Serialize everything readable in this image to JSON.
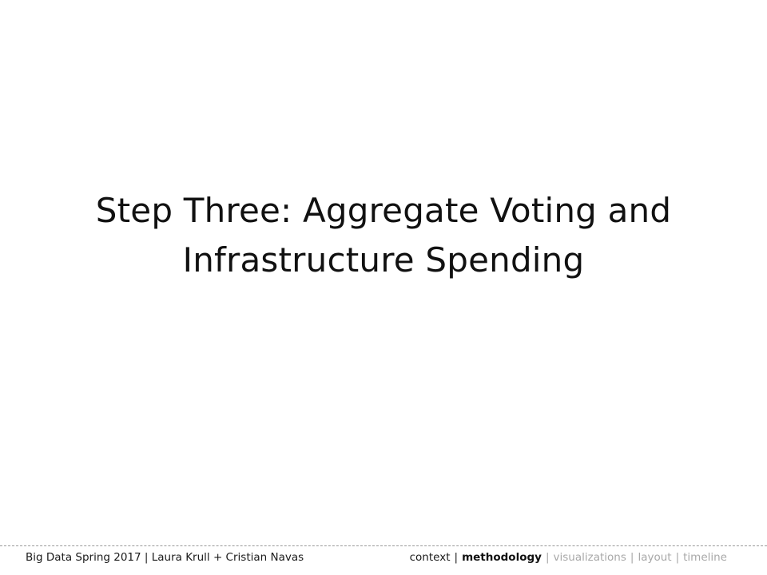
{
  "slide": {
    "title_lines": [
      "Step Three: Aggregate Voting and",
      "Infrastructure Spending"
    ]
  },
  "footer": {
    "credit": "Big Data Spring 2017 | Laura Krull + Cristian Navas",
    "nav": {
      "items": [
        "context",
        "methodology",
        "visualizations",
        "layout",
        "timeline"
      ],
      "separator": "|",
      "active": "methodology"
    }
  },
  "colors": {
    "text": "#111111",
    "nav_inactive": "#a8a8a8",
    "background": "#ffffff",
    "rule": "#9a9a9a"
  }
}
